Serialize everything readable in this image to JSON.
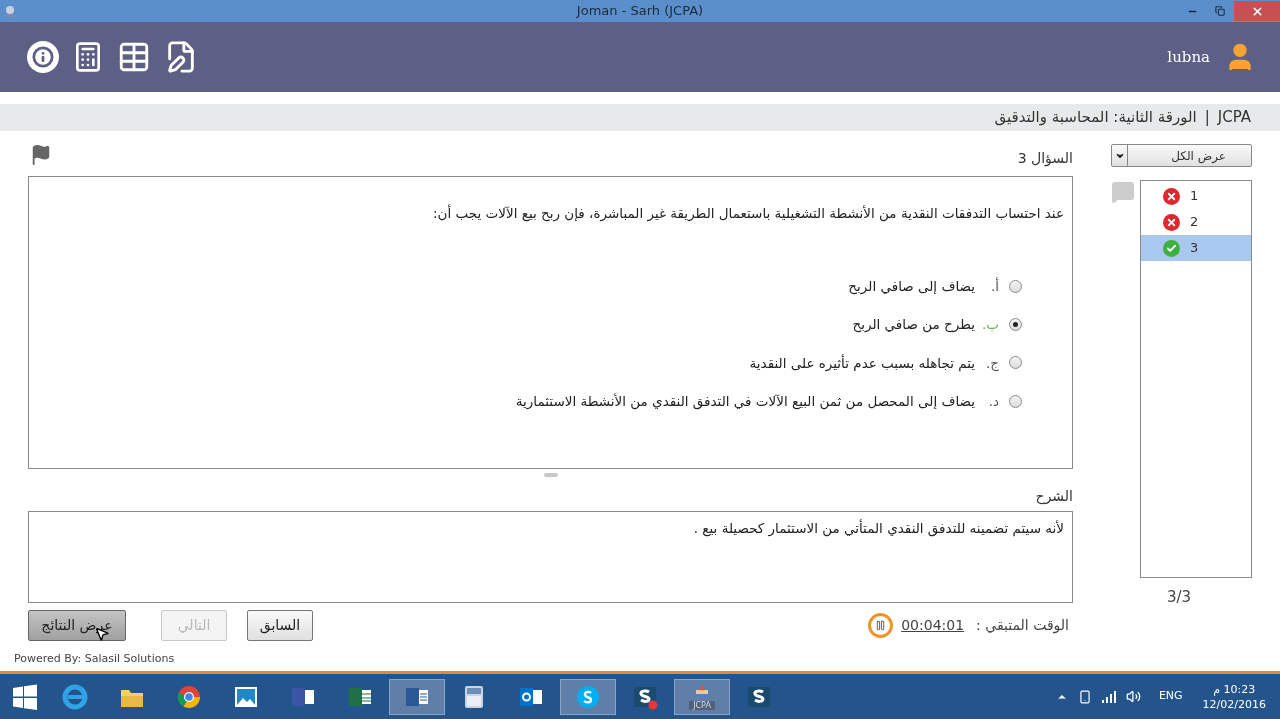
{
  "window": {
    "title": "Joman - Sarh (JCPA)"
  },
  "header": {
    "user": "lubna"
  },
  "breadcrumb": {
    "exam": "JCPA",
    "separator": "|",
    "paper": "الورقة الثانية: المحاسبة والتدقيق"
  },
  "question": {
    "heading": "السؤال 3",
    "text": "عند احتساب التدفقات النقدية من الأنشطة التشغيلية باستعمال الطريقة غير المباشرة، فإن ربح بيع الآلات يجب أن:",
    "options": [
      {
        "letter": "أ.",
        "text": "يضاف إلى صافي الربح",
        "selected": false,
        "correct": false
      },
      {
        "letter": "ب.",
        "text": "يطرح من صافي الربح",
        "selected": true,
        "correct": true
      },
      {
        "letter": "ج.",
        "text": "يتم تجاهله بسبب عدم تأثيره على النقدية",
        "selected": false,
        "correct": false
      },
      {
        "letter": "د.",
        "text": "يضاف إلى المحصل من ثمن البيع الآلات في التدفق النقدي من الأنشطة الاستثمارية",
        "selected": false,
        "correct": false
      }
    ]
  },
  "explanation": {
    "label": "الشرح",
    "text": "لأنه سيتم تضمينه للتدفق النقدي المتأتي من الاستثمار كحصيلة بيع ."
  },
  "buttons": [
    {
      "label": "السابق",
      "disabled": false
    },
    {
      "label": "التالي",
      "disabled": true
    },
    {
      "label": "عرض النتائج",
      "disabled": false
    }
  ],
  "timer": {
    "label": "الوقت المتبقي :",
    "value": "00:04:01"
  },
  "filter": {
    "value": "عرض الكل"
  },
  "question_list": [
    {
      "number": "1",
      "correct": false,
      "selected": false
    },
    {
      "number": "2",
      "correct": false,
      "selected": false
    },
    {
      "number": "3",
      "correct": true,
      "selected": true
    }
  ],
  "progress": "3/3",
  "footer": "Powered By: Salasil Solutions",
  "taskbar": {
    "apps": [
      {
        "kind": "ie",
        "active": false
      },
      {
        "kind": "folder",
        "active": false
      },
      {
        "kind": "chrome",
        "active": false
      },
      {
        "kind": "photos",
        "active": false
      },
      {
        "kind": "visio",
        "active": false
      },
      {
        "kind": "excel",
        "active": false
      },
      {
        "kind": "word",
        "active": true
      },
      {
        "kind": "calculator",
        "active": false
      },
      {
        "kind": "outlook",
        "active": false
      },
      {
        "kind": "skype",
        "active": true
      },
      {
        "kind": "snagit-record",
        "active": false
      },
      {
        "kind": "jcpa",
        "active": true,
        "label": "JCPA"
      },
      {
        "kind": "snagit",
        "active": false
      }
    ],
    "language": "ENG",
    "time": "10:23 م",
    "date": "12/02/2016"
  }
}
